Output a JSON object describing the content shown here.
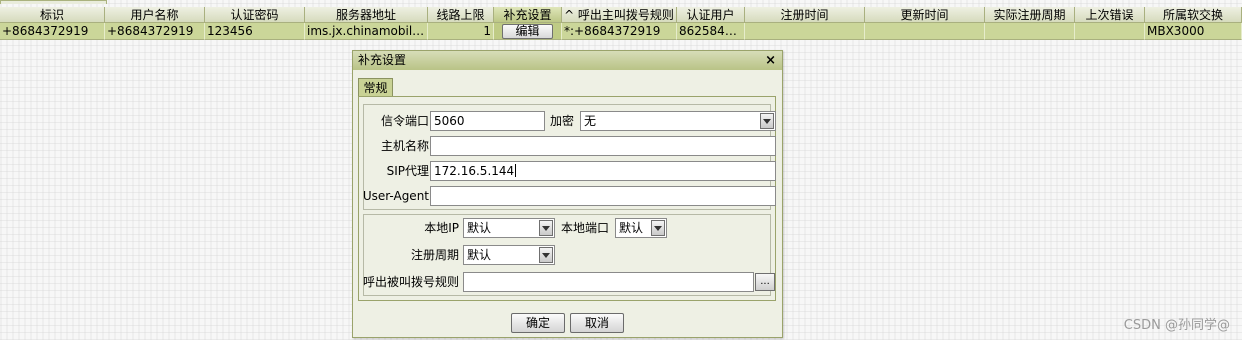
{
  "grid": {
    "columns": [
      "标识",
      "用户名称",
      "认证密码",
      "服务器地址",
      "线路上限",
      "补充设置",
      "^ 呼出主叫拨号规则",
      "认证用户",
      "注册时间",
      "更新时间",
      "实际注册周期",
      "上次错误",
      "所属软交换"
    ],
    "row": {
      "id": "+8684372919",
      "username": "+8684372919",
      "password": "123456",
      "server": "ims.jx.chinamobile....",
      "line_limit": "1",
      "edit_button": "编辑",
      "caller_rule": "*:+8684372919",
      "auth_user": "86258437...",
      "register_time": "",
      "update_time": "",
      "actual_period": "",
      "last_error": "",
      "softswitch": "MBX3000"
    }
  },
  "dialog": {
    "title": "补充设置",
    "close": "×",
    "tab": "常规",
    "signal_port_label": "信令端口",
    "signal_port": "5060",
    "encrypt_label": "加密",
    "encrypt": "无",
    "host_label": "主机名称",
    "host": "",
    "sip_proxy_label": "SIP代理",
    "sip_proxy": "172.16.5.144",
    "user_agent_label": "User-Agent",
    "user_agent": "",
    "local_ip_label": "本地IP",
    "local_ip": "默认",
    "local_port_label": "本地端口",
    "local_port": "默认",
    "reg_period_label": "注册周期",
    "reg_period": "默认",
    "callee_rule_label": "呼出被叫拨号规则",
    "callee_rule": "",
    "ellipsis": "...",
    "ok": "确定",
    "cancel": "取消"
  },
  "watermark": "CSDN @孙同学@"
}
